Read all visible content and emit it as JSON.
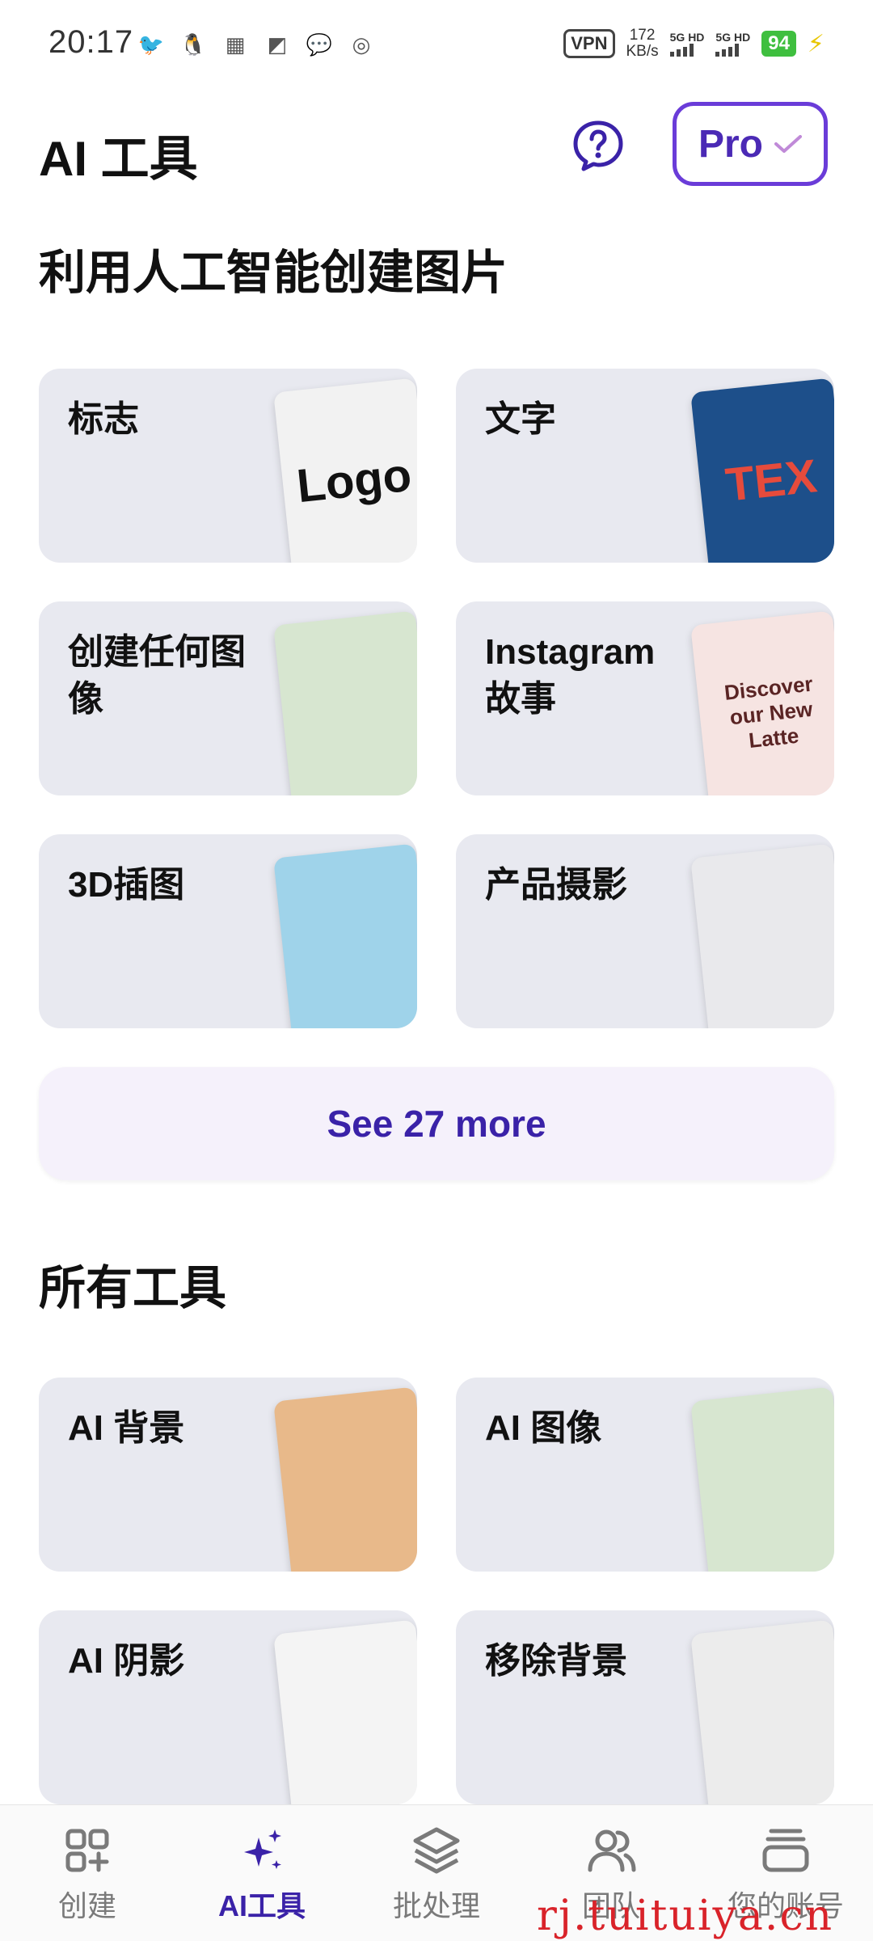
{
  "status_bar": {
    "time": "20:17",
    "icons": [
      "bird-icon",
      "penguin-icon",
      "app-icon",
      "c-icon",
      "wechat-icon",
      "check-icon"
    ],
    "vpn": "VPN",
    "speed": "172",
    "speed_unit": "KB/s",
    "net1": "5G HD",
    "net2": "5G HD",
    "battery": "94"
  },
  "header": {
    "title": "AI 工具",
    "pro_label": "Pro"
  },
  "section_create": {
    "title": "利用人工智能创建图片",
    "cards": [
      {
        "label": "标志",
        "thumb_text": "Logo",
        "thumb_bg": "#f2f2f2",
        "thumb_color": "#111"
      },
      {
        "label": "文字",
        "thumb_text": "TEX",
        "thumb_bg": "#1d4f8a",
        "thumb_color": "#e64b3c"
      },
      {
        "label": "创建任何图像",
        "thumb_text": "",
        "thumb_bg": "#d7e6d0",
        "thumb_color": "#333"
      },
      {
        "label": "Instagram 故事",
        "thumb_text": "Discover our New Latte",
        "thumb_bg": "#f6e4e2",
        "thumb_color": "#5a2424"
      },
      {
        "label": "3D插图",
        "thumb_text": "",
        "thumb_bg": "#9fd3ea",
        "thumb_color": "#333"
      },
      {
        "label": "产品摄影",
        "thumb_text": "",
        "thumb_bg": "#e9e9ec",
        "thumb_color": "#333"
      }
    ],
    "see_more": "See 27 more"
  },
  "section_tools": {
    "title": "所有工具",
    "cards": [
      {
        "label": "AI 背景",
        "thumb_text": "",
        "thumb_bg": "#e8b98a",
        "thumb_color": "#333"
      },
      {
        "label": "AI 图像",
        "thumb_text": "",
        "thumb_bg": "#d7e6d0",
        "thumb_color": "#333"
      },
      {
        "label": "AI 阴影",
        "thumb_text": "",
        "thumb_bg": "#f4f4f4",
        "thumb_color": "#333"
      },
      {
        "label": "移除背景",
        "thumb_text": "",
        "thumb_bg": "#ececec",
        "thumb_color": "#333"
      }
    ]
  },
  "bottom_nav": {
    "items": [
      {
        "label": "创建"
      },
      {
        "label": "AI工具"
      },
      {
        "label": "批处理"
      },
      {
        "label": "团队"
      },
      {
        "label": "您的账号"
      }
    ]
  },
  "watermark": "rj.tuituiya.cn",
  "colors": {
    "accent": "#3a22a8",
    "pro_border": "#6a3cd8",
    "card_bg": "#e8e9f0"
  }
}
